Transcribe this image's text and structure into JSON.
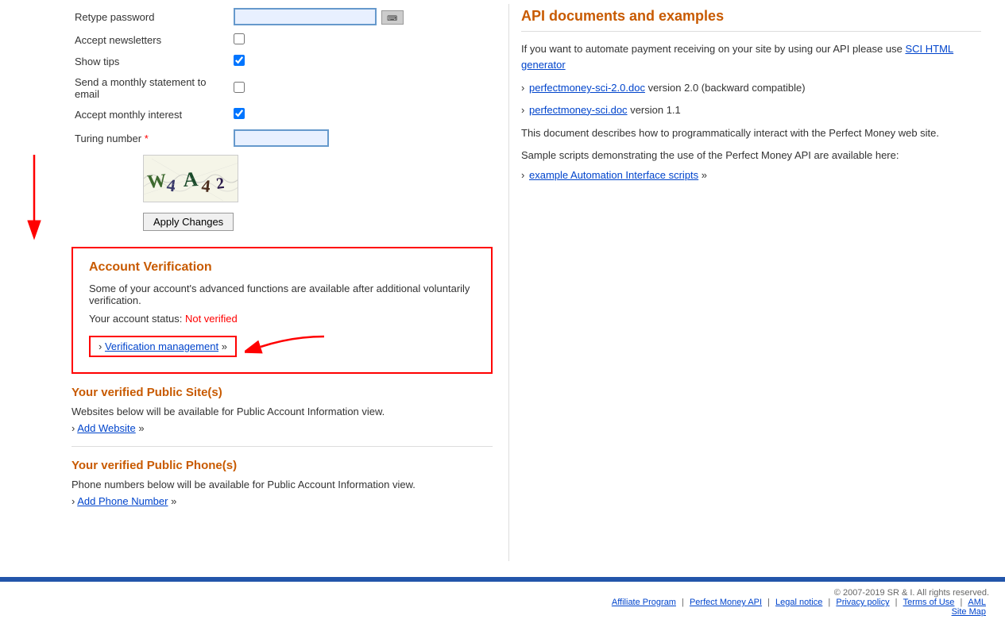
{
  "form": {
    "retype_password_label": "Retype password",
    "accept_newsletters_label": "Accept newsletters",
    "show_tips_label": "Show tips",
    "send_statement_label": "Send a monthly statement to email",
    "accept_interest_label": "Accept monthly interest",
    "turing_label": "Turing number",
    "apply_button": "Apply Changes",
    "show_tips_checked": true,
    "accept_interest_checked": true,
    "accept_newsletters_checked": false,
    "send_statement_checked": false
  },
  "verification": {
    "title": "Account Verification",
    "description": "Some of your account's advanced functions are available after additional voluntarily verification.",
    "status_label": "Your account status:",
    "status_value": "Not verified",
    "management_prefix": "›",
    "management_link": "Verification management",
    "management_suffix": "»"
  },
  "public_sites": {
    "title": "Your verified Public Site(s)",
    "description": "Websites below will be available for Public Account Information view.",
    "add_prefix": "›",
    "add_link": "Add Website",
    "add_suffix": "»"
  },
  "public_phones": {
    "title": "Your verified Public Phone(s)",
    "description": "Phone numbers below will be available for Public Account Information view.",
    "add_prefix": "›",
    "add_link": "Add Phone Number",
    "add_suffix": "»"
  },
  "api": {
    "title": "API documents and examples",
    "intro": "If you want to automate payment receiving on your site by using our API please use",
    "sci_link": "SCI HTML generator",
    "docs": [
      {
        "link": "perfectmoney-sci-2.0.doc",
        "text": "version 2.0 (backward compatible)"
      },
      {
        "link": "perfectmoney-sci.doc",
        "text": "version 1.1"
      }
    ],
    "desc": "This document describes how to programmatically interact with the Perfect Money web site.",
    "sample_text": "Sample scripts demonstrating the use of the Perfect Money API are available here:",
    "example_link": "example Automation Interface scripts",
    "example_suffix": "»"
  },
  "footer": {
    "copyright": "© 2007-2019 SR & I. All rights reserved.",
    "links": [
      "Affiliate Program",
      "Perfect Money API",
      "Legal notice",
      "Privacy policy",
      "Terms of Use",
      "AML",
      "Site Map"
    ]
  }
}
